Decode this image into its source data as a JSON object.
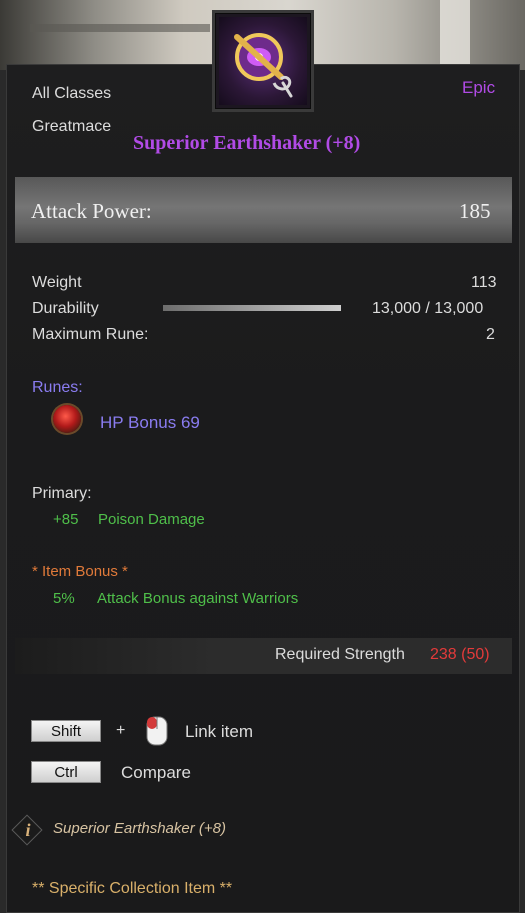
{
  "header": {
    "class_restriction": "All Classes",
    "item_type": "Greatmace",
    "rarity": "Epic",
    "item_name": "Superior Earthshaker (+8)"
  },
  "attack": {
    "label": "Attack Power:",
    "value": "185"
  },
  "stats": {
    "weight_label": "Weight",
    "weight_value": "113",
    "durability_label": "Durability",
    "durability_value": "13,000 / 13,000",
    "durability_fraction": 1.0,
    "max_rune_label": "Maximum Rune:",
    "max_rune_value": "2"
  },
  "runes": {
    "heading": "Runes:",
    "items": [
      {
        "label": "HP Bonus 69",
        "icon": "red-rune-gem-icon"
      }
    ]
  },
  "primary": {
    "heading": "Primary:",
    "value": "+85",
    "label": "Poison Damage"
  },
  "item_bonus": {
    "heading": "*  Item Bonus *",
    "value": "5%",
    "label": "Attack Bonus against Warriors"
  },
  "requirement": {
    "label": "Required Strength",
    "value": "238 (50)"
  },
  "shortcuts": {
    "shift_key": "Shift",
    "plus": "+",
    "link_label": "Link item",
    "ctrl_key": "Ctrl",
    "compare_label": "Compare"
  },
  "footer": {
    "info_item_name": "Superior Earthshaker (+8)",
    "collection_text": "** Specific Collection Item **"
  },
  "colors": {
    "epic_purple": "#b14be6",
    "rune_blue": "#8a7cf0",
    "green": "#4fbf4a",
    "orange": "#e07a3a",
    "red": "#e33a3a",
    "gold": "#d9b06a"
  }
}
